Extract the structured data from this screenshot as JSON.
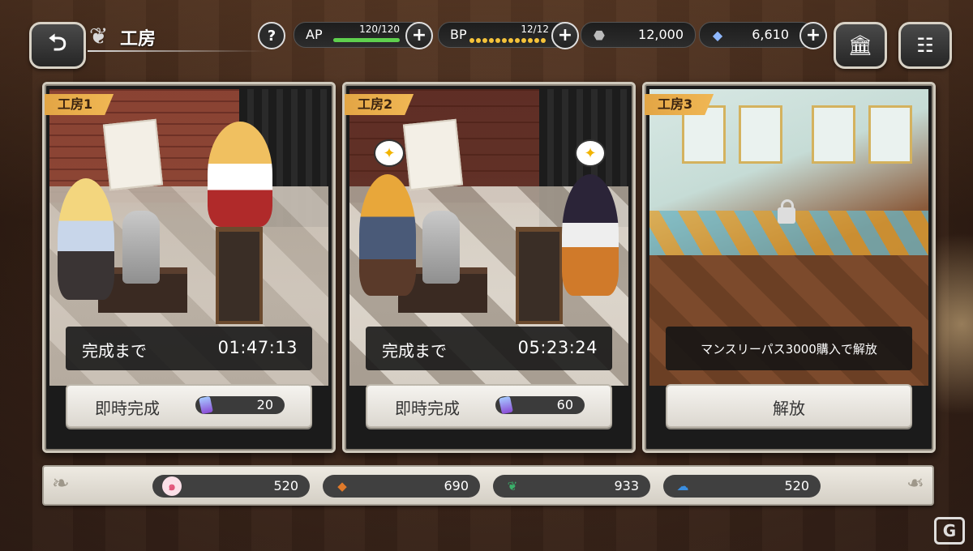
{
  "header": {
    "title": "工房",
    "help_label": "?",
    "ap": {
      "label": "AP",
      "value": "120/120",
      "fill": 1.0
    },
    "bp": {
      "label": "BP",
      "value": "12/12",
      "fill": 1.0
    },
    "currency1": {
      "icon": "ore-icon",
      "value": "12,000"
    },
    "currency2": {
      "icon": "crystal-icon",
      "value": "6,610"
    },
    "plus": "+"
  },
  "workshops": [
    {
      "tag": "工房1",
      "timer_label": "完成まで",
      "timer_value": "01:47:13",
      "action": "即時完成",
      "cost": "20"
    },
    {
      "tag": "工房2",
      "timer_label": "完成まで",
      "timer_value": "05:23:24",
      "action": "即時完成",
      "cost": "60"
    },
    {
      "tag": "工房3",
      "lock_text": "マンスリーパス3000購入で解放",
      "action": "解放"
    }
  ],
  "materials": [
    {
      "icon": "pink-swirl-icon",
      "color": "#e2557a",
      "value": "520"
    },
    {
      "icon": "orange-diamond-icon",
      "color": "#e07a2a",
      "value": "690"
    },
    {
      "icon": "green-leaf-icon",
      "color": "#3ab06a",
      "value": "933"
    },
    {
      "icon": "blue-cloud-icon",
      "color": "#3a8ee0",
      "value": "520"
    }
  ],
  "colors": {
    "tag": "#e8aa48",
    "ap_bar": "#5fd04e",
    "bp_dot": "#f5c33a"
  }
}
